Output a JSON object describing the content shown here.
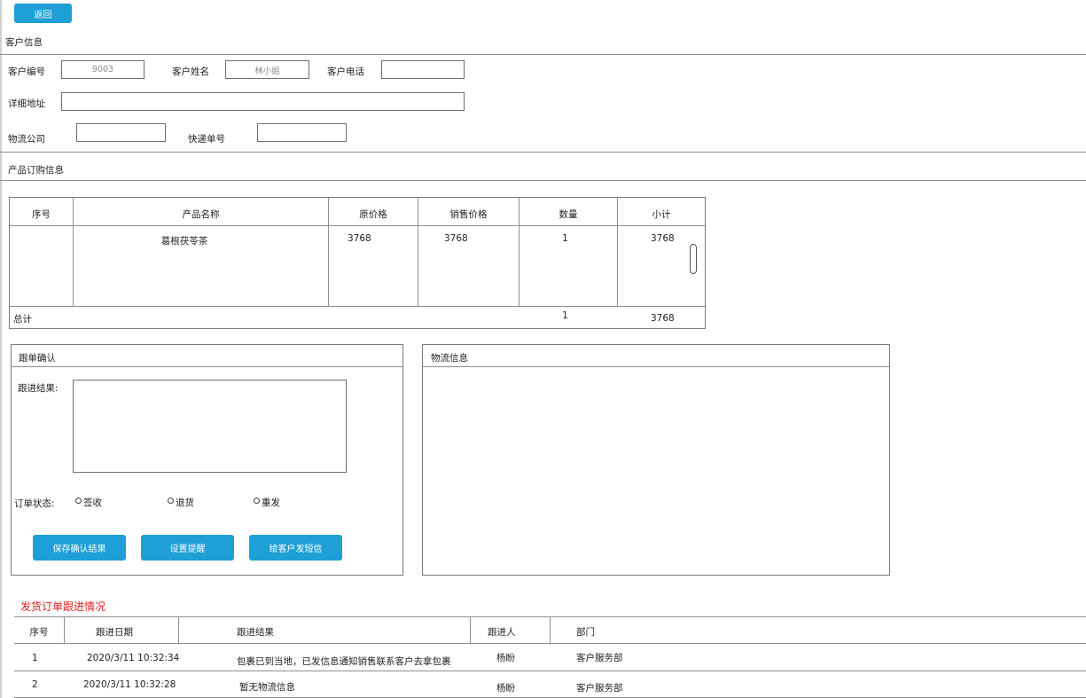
{
  "top": {
    "back_label": "返回"
  },
  "customer": {
    "section_title": "客户信息",
    "id_label": "客户编号",
    "id_value": "9003",
    "name_label": "客户姓名",
    "name_value": "林小姐",
    "phone_label": "客户电话",
    "phone_value": "",
    "address_label": "详细地址",
    "address_value": "",
    "logistics_label": "物流公司",
    "logistics_value": "",
    "tracking_label": "快递单号",
    "tracking_value": ""
  },
  "order": {
    "section_title": "产品订购信息",
    "headers": [
      "序号",
      "产品名称",
      "原价格",
      "销售价格",
      "数量",
      "小计"
    ],
    "rows": [
      {
        "index": "",
        "name": "葛根茯苓茶",
        "original_price": "3768",
        "sale_price": "3768",
        "quantity": "1",
        "subtotal": "3768"
      }
    ],
    "total_label": "总计",
    "total_quantity": "1",
    "total_amount": "3768"
  },
  "followup": {
    "panel_title": "跟单确认",
    "result_label": "跟进结果:",
    "result_value": "",
    "status_label": "订单状态:",
    "status_options": [
      "签收",
      "退货",
      "重发"
    ],
    "save_label": "保存确认结果",
    "reminder_label": "设置提醒",
    "sms_label": "给客户发短信"
  },
  "logistics_panel": {
    "title": "物流信息"
  },
  "history": {
    "title": "发货订单跟进情况",
    "title_color": "#e02020",
    "headers": [
      "序号",
      "跟进日期",
      "跟进结果",
      "跟进人",
      "部门"
    ],
    "rows": [
      {
        "index": "1",
        "date": "2020/3/11 10:32:34",
        "result": "包裹已到当地，已发信息通知销售联系客户去拿包裹",
        "person": "杨盼",
        "dept": "客户服务部"
      },
      {
        "index": "2",
        "date": "2020/3/11 10:32:28",
        "result": "暂无物流信息",
        "person": "杨盼",
        "dept": "客户服务部"
      }
    ]
  },
  "colors": {
    "accent": "#1e9fd6"
  }
}
